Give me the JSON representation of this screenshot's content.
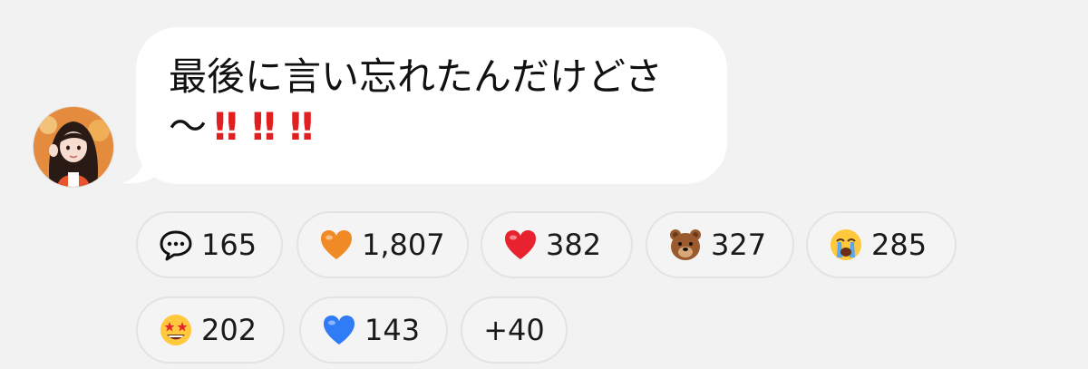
{
  "message": {
    "line1": "最後に言い忘れたんだけどさ",
    "line2_text": "〜",
    "line2_exclaims": [
      "‼",
      "‼",
      "‼"
    ]
  },
  "reactions": {
    "comments": {
      "icon": "speech-bubble-icon",
      "count": "165"
    },
    "orange_heart": {
      "icon": "orange-heart-icon",
      "color": "#f08a24",
      "count": "1,807"
    },
    "red_heart": {
      "icon": "red-heart-icon",
      "color": "#e8232f",
      "count": "382"
    },
    "bear": {
      "icon": "bear-face-icon",
      "color": "#9a5a2e",
      "count": "327"
    },
    "crying": {
      "icon": "loudly-crying-face-icon",
      "color": "#ffc83d",
      "count": "285"
    },
    "star_struck": {
      "icon": "star-struck-face-icon",
      "color": "#ffc83d",
      "count": "202"
    },
    "blue_heart": {
      "icon": "blue-heart-icon",
      "color": "#2f7cf6",
      "count": "143"
    },
    "more": {
      "label": "+40"
    }
  }
}
